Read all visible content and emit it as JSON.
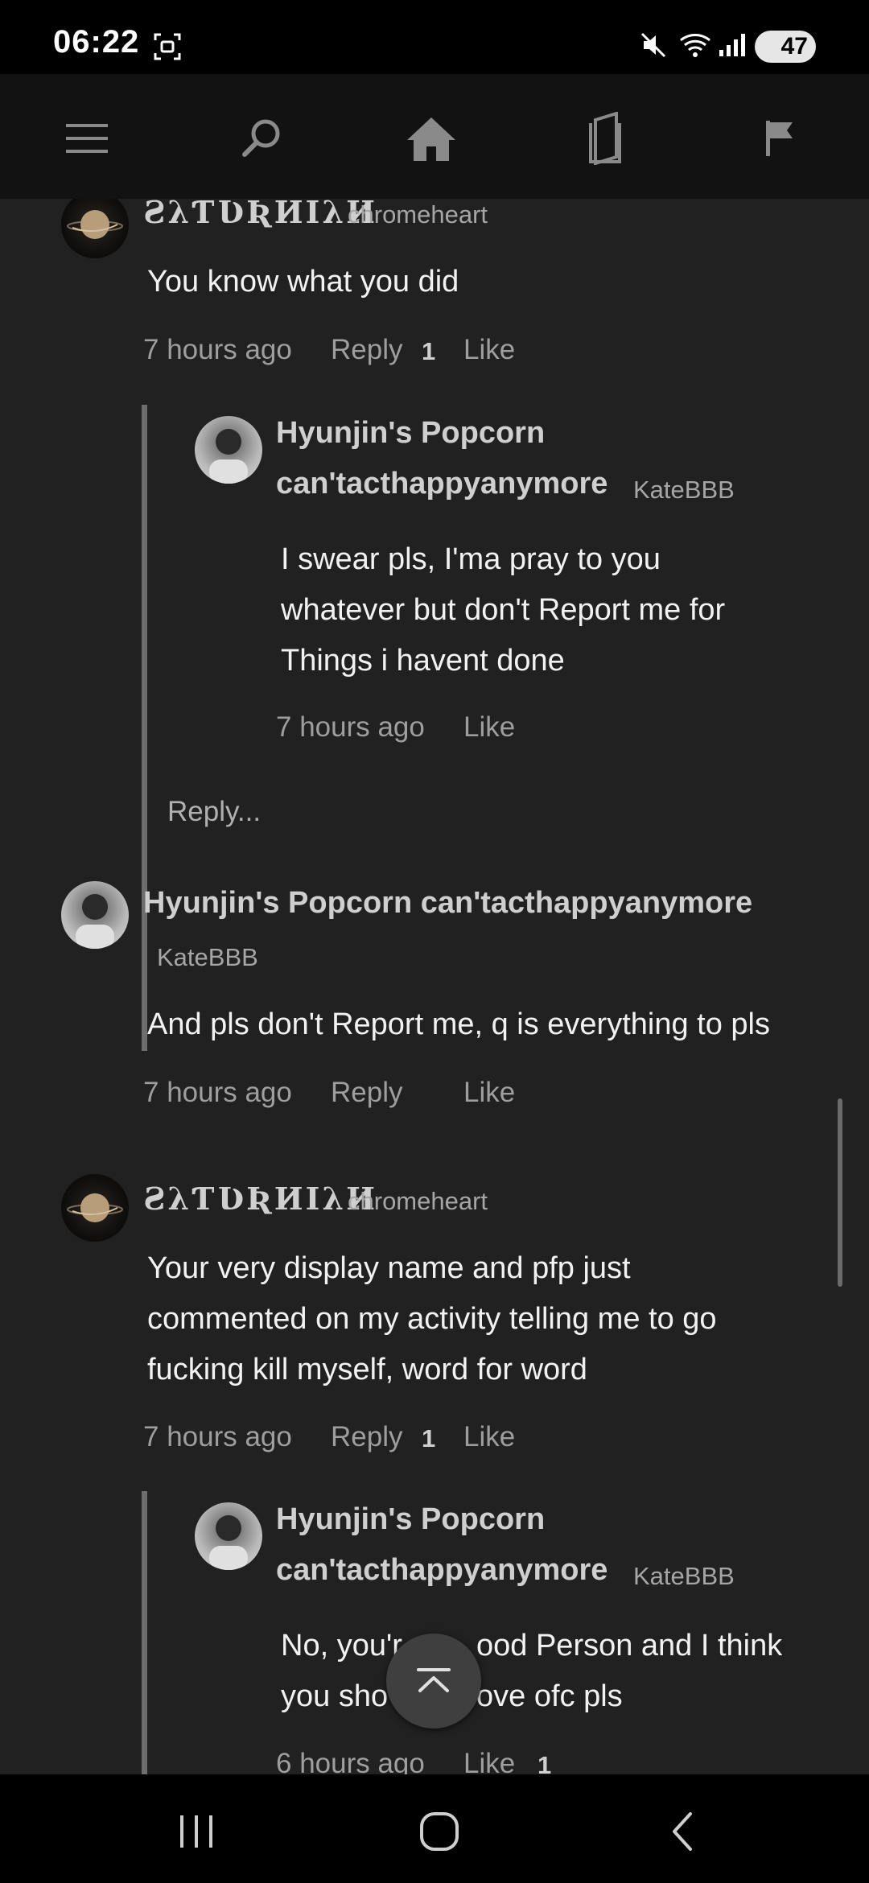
{
  "status_bar": {
    "time": "06:22",
    "battery": "47",
    "icons": [
      "screenshot-icon",
      "mute-icon",
      "wifi-icon",
      "signal-icon"
    ]
  },
  "top_nav": {
    "items": [
      "menu-icon",
      "search-icon",
      "home-icon",
      "library-icon",
      "flag-icon"
    ]
  },
  "comments": [
    {
      "display_name": "ƧλƬƲƦИIλИ",
      "username": "chromeheart",
      "text": "You know what you did",
      "time": "7 hours ago",
      "reply_label": "Reply",
      "like_count": "1",
      "like_label": "Like"
    },
    {
      "display_name_line1": "Hyunjin's Popcorn",
      "display_name_line2": "can'tacthappyanymore",
      "username": "KateBBB",
      "text_lines": [
        "I swear pls, I'ma pray to you",
        "whatever but don't Report me for",
        "Things i havent done"
      ],
      "time": "7 hours ago",
      "like_label": "Like",
      "reply_prompt": "Reply..."
    },
    {
      "display_name": "Hyunjin's Popcorn can'tacthappyanymore",
      "username": "KateBBB",
      "text": "And pls don't Report me, q is everything to pls",
      "time": "7 hours ago",
      "reply_label": "Reply",
      "like_label": "Like"
    },
    {
      "display_name": "ƧλƬƲƦИIλИ",
      "username": "chromeheart",
      "text_lines": [
        "Your very display name and pfp just",
        "commented on my activity telling me to go",
        "fucking kill myself, word for word"
      ],
      "time": "7 hours ago",
      "reply_label": "Reply",
      "like_count": "1",
      "like_label": "Like"
    },
    {
      "display_name_line1": "Hyunjin's Popcorn",
      "display_name_line2": "can'tacthappyanymore",
      "username": "KateBBB",
      "text_lines": [
        "No, you'r",
        "ood Person and I think",
        "you sho",
        "ove ofc pls"
      ],
      "time": "6 hours ago",
      "like_label": "Like",
      "like_count": "1"
    }
  ],
  "scroll_top_icon": "chevron-up-icon",
  "system_nav": [
    "recents-icon",
    "home-circle-icon",
    "back-icon"
  ]
}
